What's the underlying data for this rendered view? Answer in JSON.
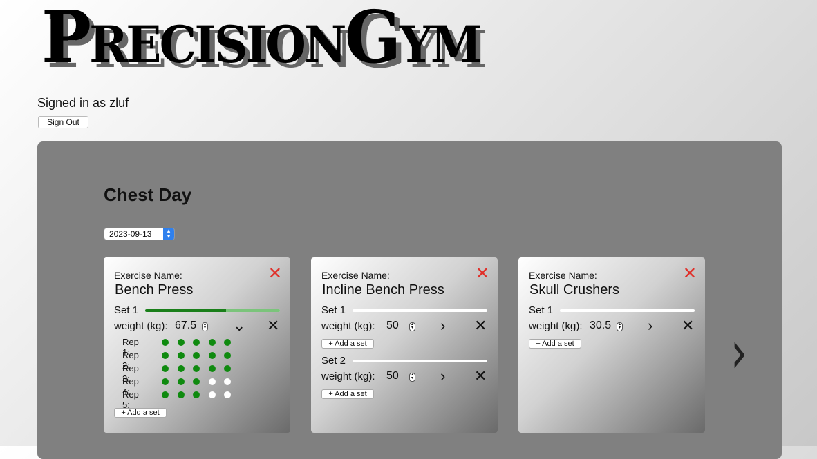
{
  "app": {
    "logo": "PrecisionGym"
  },
  "user": {
    "signed_in_text": "Signed in as zluf",
    "sign_out_label": "Sign Out"
  },
  "workout": {
    "title": "Chest Day",
    "date": "2023-09-13",
    "exercise_label": "Exercise Name:",
    "weight_label": "weight (kg):",
    "add_set_label": "+ Add a set",
    "exercises": [
      {
        "name": "Bench Press",
        "sets": [
          {
            "label": "Set 1",
            "weight": "67.5",
            "expanded": true,
            "progress_fraction": 0.6,
            "reps": [
              {
                "label": "Rep 1:",
                "completed": 5,
                "total": 5
              },
              {
                "label": "Rep 2:",
                "completed": 5,
                "total": 5
              },
              {
                "label": "Rep 3:",
                "completed": 5,
                "total": 5
              },
              {
                "label": "Rep 4:",
                "completed": 3,
                "total": 5
              },
              {
                "label": "Rep 5:",
                "completed": 3,
                "total": 5
              }
            ]
          }
        ]
      },
      {
        "name": "Incline Bench Press",
        "sets": [
          {
            "label": "Set 1",
            "weight": "50",
            "expanded": false,
            "progress_fraction": 0
          },
          {
            "label": "Set 2",
            "weight": "50",
            "expanded": false,
            "progress_fraction": 0
          }
        ]
      },
      {
        "name": "Skull Crushers",
        "sets": [
          {
            "label": "Set 1",
            "weight": "30.5",
            "expanded": false,
            "progress_fraction": 0
          }
        ]
      }
    ]
  },
  "colors": {
    "remove": "#e0302a",
    "rep_done": "#0f8a0f",
    "rep_todo": "#ffffff",
    "progress_dark": "#1a7f1a",
    "progress_light": "#7bc47b",
    "panel": "#808080"
  },
  "icons": {
    "remove": "close-icon",
    "expanded": "chevron-down-icon",
    "collapsed": "chevron-right-icon",
    "delete_set": "x-icon",
    "next": "chevron-right-icon"
  }
}
